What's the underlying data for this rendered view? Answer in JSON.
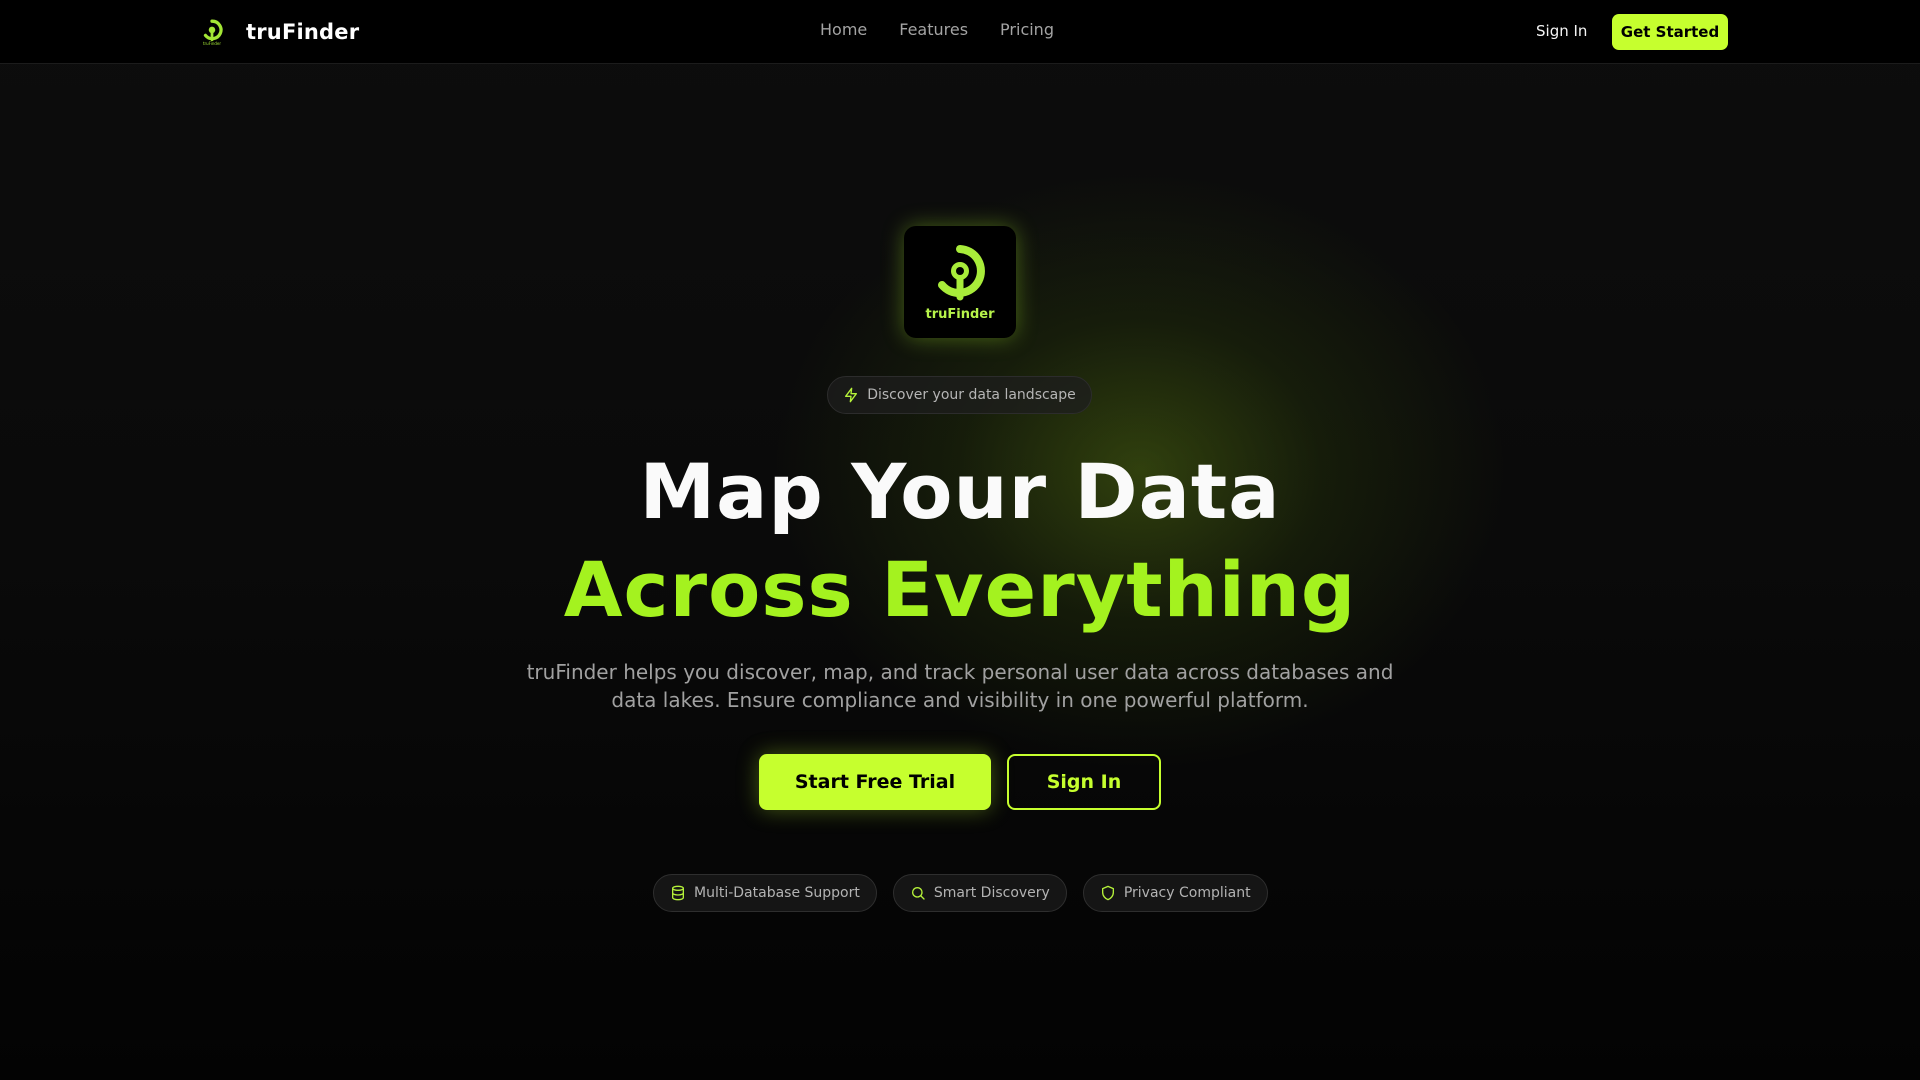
{
  "nav": {
    "brand": "truFinder",
    "brand_mark_caption": "truFinder",
    "links": [
      "Home",
      "Features",
      "Pricing"
    ],
    "sign_in": "Sign In",
    "cta": "Get Started"
  },
  "hero": {
    "logo_caption": "truFinder",
    "badge": "Discover your data landscape",
    "title_line1": "Map Your Data",
    "title_line2": "Across Everything",
    "subtitle": "truFinder helps you discover, map, and track personal user data across databases and data lakes. Ensure compliance and visibility in one powerful platform.",
    "primary_cta": "Start Free Trial",
    "secondary_cta": "Sign In",
    "features": [
      {
        "label": "Multi-Database Support",
        "icon": "database-icon"
      },
      {
        "label": "Smart Discovery",
        "icon": "search-icon"
      },
      {
        "label": "Privacy Compliant",
        "icon": "shield-icon"
      }
    ]
  },
  "colors": {
    "accent": "#c6ff2e",
    "accent_text": "#a4f21f",
    "background": "#0a0a0a"
  }
}
